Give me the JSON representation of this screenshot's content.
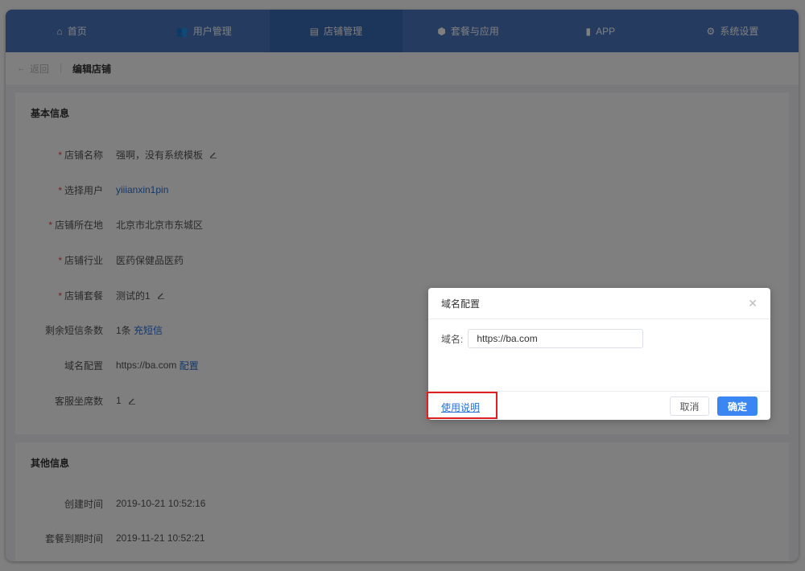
{
  "nav": {
    "items": [
      {
        "label": "首页",
        "icon": "home-icon",
        "glyph": "⌂"
      },
      {
        "label": "用户管理",
        "icon": "users-icon",
        "glyph": "👥"
      },
      {
        "label": "店铺管理",
        "icon": "store-icon",
        "glyph": "▤"
      },
      {
        "label": "套餐与应用",
        "icon": "package-icon",
        "glyph": "⬢"
      },
      {
        "label": "APP",
        "icon": "phone-icon",
        "glyph": "▮"
      },
      {
        "label": "系统设置",
        "icon": "gear-icon",
        "glyph": "⚙"
      }
    ],
    "active_index": 2,
    "color": "#4a78c0"
  },
  "breadcrumb": {
    "back_label": "返回",
    "current": "编辑店铺"
  },
  "basic_info": {
    "title": "基本信息",
    "rows": [
      {
        "label": "店铺名称",
        "required": true,
        "value": "强啊，没有系统模板",
        "editable": true
      },
      {
        "label": "选择用户",
        "required": true,
        "value": "yiiianxin1pin",
        "is_link": true
      },
      {
        "label": "店铺所在地",
        "required": true,
        "value": "北京市北京市东城区"
      },
      {
        "label": "店铺行业",
        "required": true,
        "value": "医药保健品医药"
      },
      {
        "label": "店铺套餐",
        "required": true,
        "value": "测试的1",
        "editable": true
      },
      {
        "label": "剩余短信条数",
        "required": false,
        "value": "1条",
        "link_text": "充短信"
      },
      {
        "label": "域名配置",
        "required": false,
        "value": "https://ba.com",
        "link_text": "配置"
      },
      {
        "label": "客服坐席数",
        "required": false,
        "value": "1",
        "editable": true
      }
    ]
  },
  "other_info": {
    "title": "其他信息",
    "rows": [
      {
        "label": "创建时间",
        "value": "2019-10-21 10:52:16"
      },
      {
        "label": "套餐到期时间",
        "value": "2019-11-21 10:52:21"
      }
    ]
  },
  "modal": {
    "title": "域名配置",
    "close_icon": "close-icon",
    "field_label": "域名:",
    "field_value": "https://ba.com",
    "help_link": "使用说明",
    "cancel_label": "取消",
    "confirm_label": "确定",
    "accent": "#3a86f2"
  },
  "highlight_color": "#e02020"
}
